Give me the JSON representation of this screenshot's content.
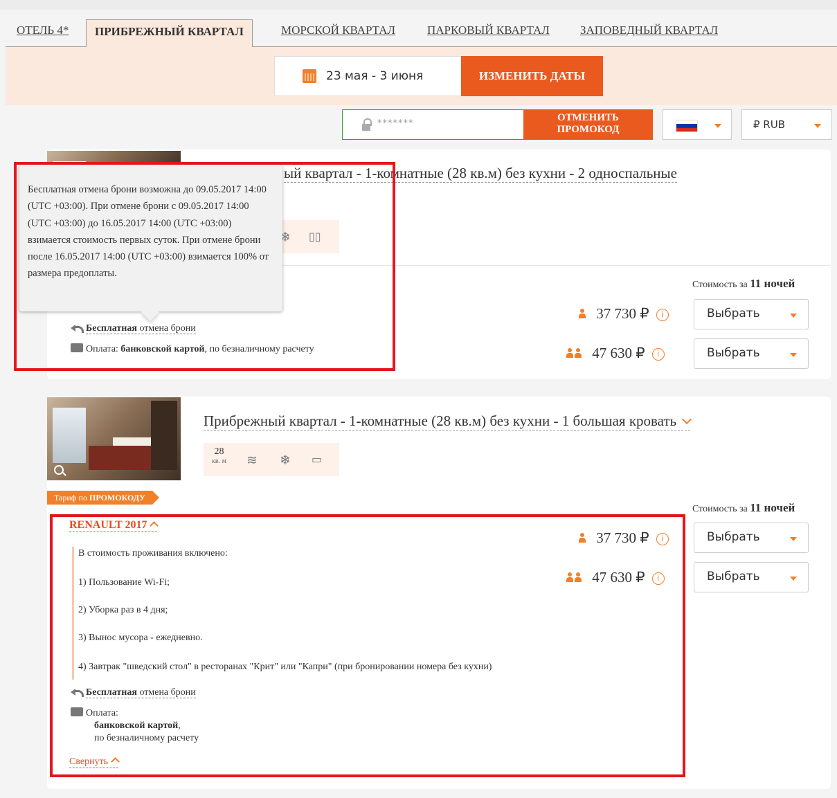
{
  "tabs": [
    {
      "label": "ОТЕЛЬ 4*"
    },
    {
      "label": "ПРИБРЕЖНЫЙ КВАРТАЛ"
    },
    {
      "label": "МОРСКОЙ КВАРТАЛ"
    },
    {
      "label": "ПАРКОВЫЙ КВАРТАЛ"
    },
    {
      "label": "ЗАПОВЕДНЫЙ КВАРТАЛ"
    }
  ],
  "active_tab": "ПРИБРЕЖНЫЙ КВАРТАЛ",
  "dates": {
    "range": "23 мая - 3 июня",
    "change_label": "ИЗМЕНИТЬ ДАТЫ",
    "icon": "calendar-icon"
  },
  "promo": {
    "value": "*******",
    "cancel_label_1": "ОТМЕНИТЬ",
    "cancel_label_2": "ПРОМОКОД",
    "icon": "lock-icon"
  },
  "language": {
    "flag": "russia-flag",
    "flag_colors": [
      "#ffffff",
      "#0039a6",
      "#d52b1e"
    ]
  },
  "currency": {
    "label": "₽ RUB"
  },
  "colors": {
    "accent": "#ea5a1f",
    "highlight": "#e3161f",
    "promo_border": "#3d9b3d"
  },
  "room1": {
    "title": "ый квартал - 1-комнатные (28 кв.м) без кухни - 2 односпальные",
    "cost_prefix": "Стоимость за ",
    "cost_nights": "11 ночей",
    "price_1": "37 730 ₽",
    "price_2": "47 630 ₽",
    "select_label": "Выбрать",
    "cancel_bold": "Бесплатная",
    "cancel_rest": " отмена брони",
    "payment_prefix": "Оплата: ",
    "payment_bold": "банковской картой",
    "payment_rest": ", по безналичному расчету"
  },
  "tooltip": {
    "text": "Бесплатная отмена брони возможна до 09.05.2017 14:00 (UTC +03:00). При отмене брони с 09.05.2017 14:00 (UTC +03:00) до 16.05.2017 14:00 (UTC +03:00) взимается стоимость первых суток. При отмене брони после 16.05.2017 14:00 (UTC +03:00) взимается 100% от размера предоплаты."
  },
  "room2": {
    "title": "Прибрежный квартал - 1-комнатные (28 кв.м) без кухни - 1 большая кровать",
    "area_num": "28",
    "area_unit": "кв. м",
    "promo_tariff_prefix": "Тариф по ",
    "promo_tariff_bold": "ПРОМОКОДУ",
    "cost_prefix": "Стоимость за ",
    "cost_nights": "11 ночей",
    "tariff_name": "RENAULT 2017",
    "price_1": "37 730 ₽",
    "price_2": "47 630 ₽",
    "select_label": "Выбрать",
    "included": [
      "В стоимость проживания включено:",
      "1) Пользование Wi-Fi;",
      "2) Уборка раз в 4 дня;",
      "3) Вынос мусора - ежедневно.",
      "4) Завтрак \"шведский стол\" в ресторанах \"Крит\" или \"Капри\" (при бронировании номера без кухни)"
    ],
    "cancel_bold": "Бесплатная",
    "cancel_rest": " отмена брони",
    "payment_label": "Оплата:",
    "payment_bold": "банковской картой",
    "payment_comma": ",",
    "payment_rest": "по безналичному расчету",
    "collapse_label": "Свернуть"
  }
}
